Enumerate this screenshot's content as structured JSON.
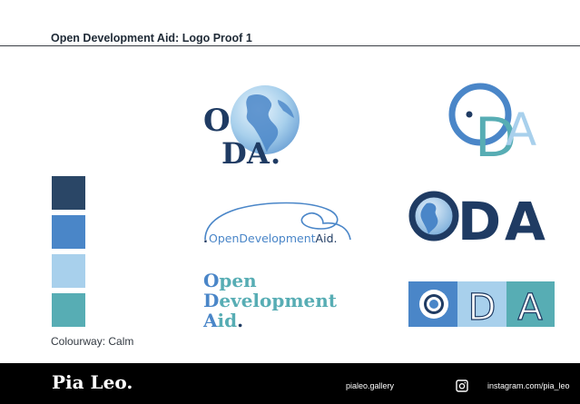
{
  "header": {
    "title": "Open Development Aid: Logo Proof 1"
  },
  "palette": {
    "label": "Colourway: Calm",
    "swatches": [
      "#2a4666",
      "#4a86c8",
      "#a8d0ec",
      "#57adb4"
    ]
  },
  "logos": {
    "globe_oda": {
      "letters": [
        "O",
        "D",
        "A",
        "."
      ],
      "colors": [
        "#1f3b63",
        "#4a86c8",
        "#a8d0ec"
      ]
    },
    "ring_oda": {
      "letters": [
        "D",
        "A"
      ],
      "colors": [
        "#4a86c8",
        "#57adb4",
        "#a8d0ec"
      ]
    },
    "script_wordmark": {
      "parts": [
        ".",
        "Open",
        "Development",
        "Aid",
        "."
      ]
    },
    "bold_oda": {
      "letters": [
        "O",
        "D",
        "A"
      ],
      "colors": [
        "#1f3b63",
        "#4a86c8"
      ]
    },
    "stacked_wordmark": {
      "lines": [
        {
          "initial": "O",
          "rest": "pen"
        },
        {
          "initial": "D",
          "rest": "evelopment"
        },
        {
          "initial": "A",
          "rest": "id"
        }
      ],
      "dot": "."
    },
    "block_oda": {
      "letters": [
        "D",
        "A"
      ],
      "colors": [
        "#4a86c8",
        "#a8d0ec",
        "#57adb4",
        "#1f3b63"
      ]
    }
  },
  "footer": {
    "brand": "Pia Leo.",
    "website": "pialeo.gallery",
    "instagram_icon": "instagram-icon",
    "instagram": "instagram.com/pia_leo"
  }
}
